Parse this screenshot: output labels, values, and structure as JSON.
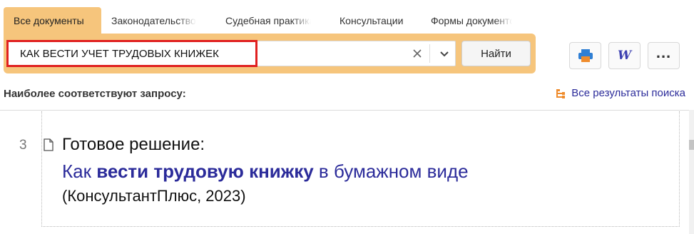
{
  "tabs": [
    {
      "label": "Все документы",
      "active": true
    },
    {
      "label": "Законодательство",
      "active": false
    },
    {
      "label": "Судебная практика",
      "active": false
    },
    {
      "label": "Консультации",
      "active": false
    },
    {
      "label": "Формы документов",
      "active": false
    }
  ],
  "search": {
    "value": "КАК ВЕСТИ УЧЕТ ТРУДОВЫХ КНИЖЕК",
    "find_label": "Найти"
  },
  "icons": {
    "clear": "close-icon",
    "dropdown": "chevron-down-icon",
    "print": "printer-icon",
    "word": "word-export-icon",
    "more": "more-dots-icon",
    "all_results": "tree-list-icon",
    "document": "document-icon"
  },
  "results": {
    "heading": "Наиболее соответствуют запросу:",
    "all_link": "Все результаты поиска",
    "items": [
      {
        "number": "3",
        "type_label": "Готовое решение:",
        "title_pre": "Как ",
        "title_bold": "вести трудовую книжку",
        "title_post": " в бумажном виде",
        "source": "(КонсультантПлюс, 2023)"
      }
    ]
  },
  "colors": {
    "accent": "#f6c57c",
    "link": "#2b2b9a",
    "highlight_border": "#e02020",
    "icon_orange": "#ef8c2d"
  }
}
